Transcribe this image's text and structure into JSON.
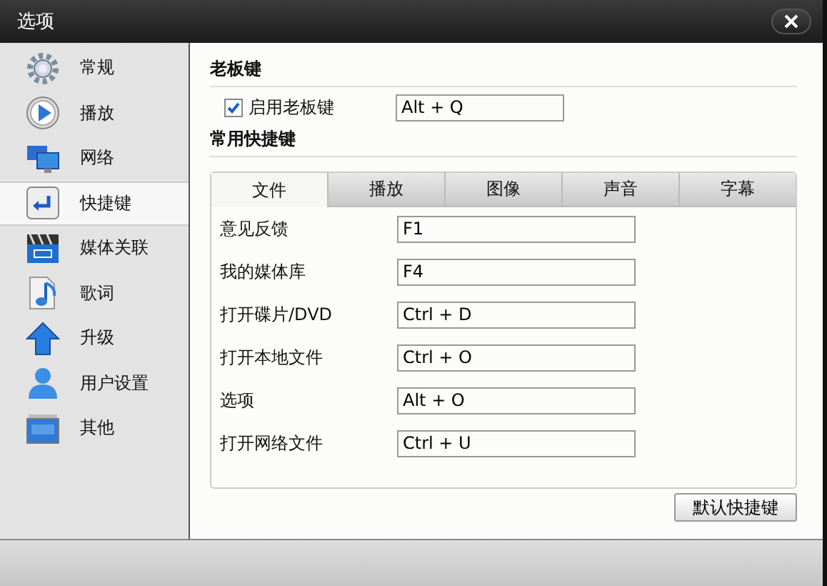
{
  "window": {
    "title": "选项"
  },
  "sidebar": {
    "items": [
      {
        "label": "常规",
        "kind": "gear",
        "selected": false
      },
      {
        "label": "播放",
        "kind": "play",
        "selected": false
      },
      {
        "label": "网络",
        "kind": "network",
        "selected": false
      },
      {
        "label": "快捷键",
        "kind": "enter",
        "selected": true
      },
      {
        "label": "媒体关联",
        "kind": "clapper",
        "selected": false
      },
      {
        "label": "歌词",
        "kind": "music",
        "selected": false
      },
      {
        "label": "升级",
        "kind": "upgrade",
        "selected": false
      },
      {
        "label": "用户设置",
        "kind": "user",
        "selected": false
      },
      {
        "label": "其他",
        "kind": "etc",
        "selected": false
      }
    ]
  },
  "boss_key": {
    "heading": "老板键",
    "label": "启用老板键",
    "checked": true,
    "value": "Alt + Q"
  },
  "shortcuts": {
    "heading": "常用快捷键",
    "tabs": [
      {
        "label": "文件",
        "selected": true
      },
      {
        "label": "播放",
        "selected": false
      },
      {
        "label": "图像",
        "selected": false
      },
      {
        "label": "声音",
        "selected": false
      },
      {
        "label": "字幕",
        "selected": false
      }
    ],
    "rows": [
      {
        "label": "意见反馈",
        "value": "F1"
      },
      {
        "label": "我的媒体库",
        "value": "F4"
      },
      {
        "label": "打开碟片/DVD",
        "value": "Ctrl + D"
      },
      {
        "label": "打开本地文件",
        "value": "Ctrl + O"
      },
      {
        "label": "选项",
        "value": "Alt + O"
      },
      {
        "label": "打开网络文件",
        "value": "Ctrl + U"
      }
    ]
  },
  "buttons": [
    "默认快捷键"
  ]
}
